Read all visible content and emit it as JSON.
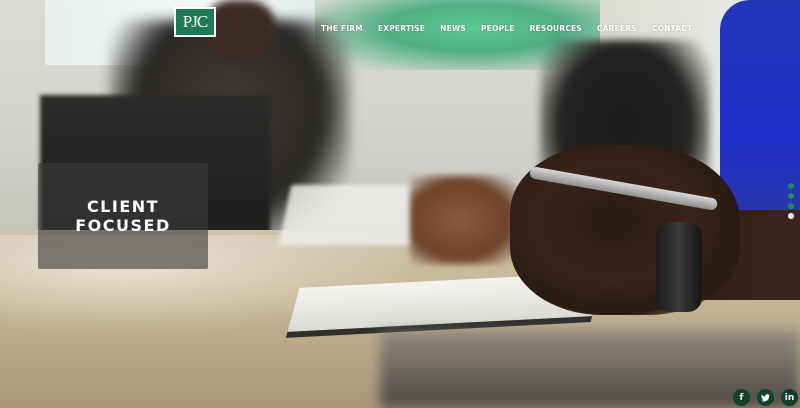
{
  "header": {
    "logo_text": "PJC",
    "nav": [
      "THE FIRM",
      "EXPERTISE",
      "NEWS",
      "PEOPLE",
      "RESOURCES",
      "CAREERS",
      "CONTACT"
    ]
  },
  "hero": {
    "caption_line1": "CLIENT",
    "caption_line2": "FOCUSED",
    "slide_count": 4,
    "active_slide": 4
  },
  "social": {
    "facebook_glyph": "f",
    "twitter_glyph": "🐦",
    "linkedin_glyph": "in",
    "icons": [
      "facebook-icon",
      "twitter-icon",
      "linkedin-icon"
    ]
  },
  "colors": {
    "brand_green": "#1e7a55",
    "dot_green": "#1f8a5a",
    "social_bg": "#143f2c"
  }
}
